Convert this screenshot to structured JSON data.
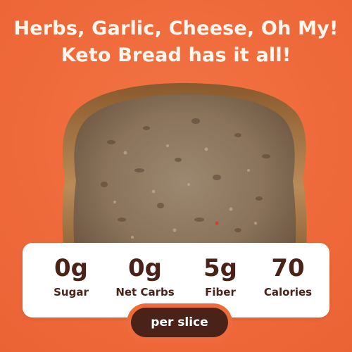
{
  "headline": {
    "line1": "Herbs, Garlic, Cheese, Oh My!",
    "line2": "Keto Bread has it all!"
  },
  "image": {
    "subject": "bread-slice-image"
  },
  "stats": [
    {
      "value": "0g",
      "label": "Sugar"
    },
    {
      "value": "0g",
      "label": "Net Carbs"
    },
    {
      "value": "5g",
      "label": "Fiber"
    },
    {
      "value": "70",
      "label": "Calories"
    }
  ],
  "badge": {
    "label": "per slice"
  },
  "colors": {
    "background": "#EF6A3A",
    "text_light": "#FFF7EE",
    "text_dark": "#4A2218",
    "card": "#FFFFFF"
  }
}
